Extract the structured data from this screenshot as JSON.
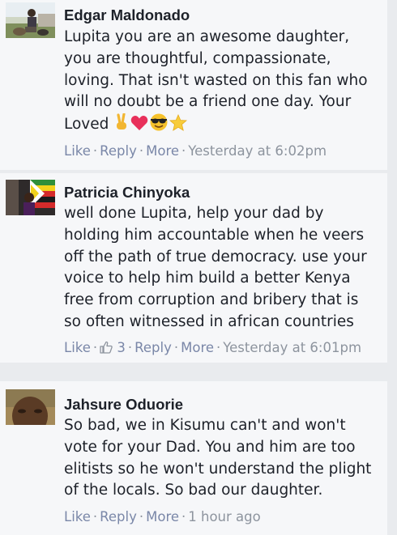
{
  "comments": [
    {
      "author": "Edgar Maldonado",
      "text_lines": [
        "Lupita you are an awesome daughter,",
        "you are thoughtful, compassionate,",
        "loving. That isn't wasted on this fan who",
        "will no doubt be a friend one day. Your",
        "Loved"
      ],
      "emojis": [
        "victory-hand",
        "red-heart",
        "sunglasses-face",
        "star"
      ],
      "actions": {
        "like": "Like",
        "reply": "Reply",
        "more": "More",
        "time": "Yesterday at 6:02pm"
      }
    },
    {
      "author": "Patricia Chinyoka",
      "text_lines": [
        "well done Lupita, help your dad by",
        "holding him accountable when he veers",
        "off the path of true democracy. use your",
        "voice to help him build a better Kenya",
        "free from corruption and bribery that is",
        "so often witnessed in african countries"
      ],
      "actions": {
        "like": "Like",
        "like_count": "3",
        "reply": "Reply",
        "more": "More",
        "time": "Yesterday at 6:01pm"
      }
    },
    {
      "author": "Jahsure Oduorie",
      "text_lines": [
        "So bad, we in Kisumu can't and won't",
        "vote for your Dad. You and him are too",
        "elitists so he won't understand the plight",
        "of the locals. So bad our daughter."
      ],
      "actions": {
        "like": "Like",
        "reply": "Reply",
        "more": "More",
        "time": "1 hour ago"
      }
    }
  ],
  "separator": "·",
  "colors": {
    "background": "#e9ebee",
    "card": "#f6f7f9",
    "text": "#1d2129",
    "link": "#7a87a8",
    "meta": "#8d949e"
  }
}
